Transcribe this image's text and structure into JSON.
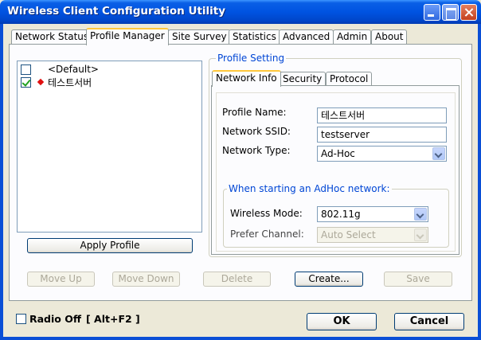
{
  "window": {
    "title": "Wireless Client Configuration Utility"
  },
  "tabs": [
    {
      "label": "Network Status",
      "active": false
    },
    {
      "label": "Profile Manager",
      "active": true
    },
    {
      "label": "Site Survey",
      "active": false
    },
    {
      "label": "Statistics",
      "active": false
    },
    {
      "label": "Advanced",
      "active": false
    },
    {
      "label": "Admin",
      "active": false
    },
    {
      "label": "About",
      "active": false
    }
  ],
  "profiles": [
    {
      "label": "<Default>",
      "checked": false,
      "active_marker": false
    },
    {
      "label": "테스트서버",
      "checked": true,
      "active_marker": true
    }
  ],
  "buttons": {
    "apply_profile": "Apply Profile",
    "move_up": "Move Up",
    "move_down": "Move Down",
    "delete": "Delete",
    "create": "Create...",
    "save": "Save",
    "ok": "OK",
    "cancel": "Cancel"
  },
  "profile_setting": {
    "group_label": "Profile Setting",
    "tabs": [
      {
        "label": "Network Info",
        "active": true
      },
      {
        "label": "Security",
        "active": false
      },
      {
        "label": "Protocol",
        "active": false
      }
    ],
    "profile_name_label": "Profile Name:",
    "profile_name_value": "테스트서버",
    "ssid_label": "Network SSID:",
    "ssid_value": "testserver",
    "network_type_label": "Network Type:",
    "network_type_value": "Ad-Hoc",
    "adhoc_group_label": "When starting an AdHoc network:",
    "wireless_mode_label": "Wireless Mode:",
    "wireless_mode_value": "802.11g",
    "prefer_channel_label": "Prefer Channel:",
    "prefer_channel_value": "Auto Select"
  },
  "footer": {
    "radio_off_label": "Radio Off",
    "radio_off_shortcut": "[ Alt+F2 ]",
    "radio_off_checked": false
  }
}
